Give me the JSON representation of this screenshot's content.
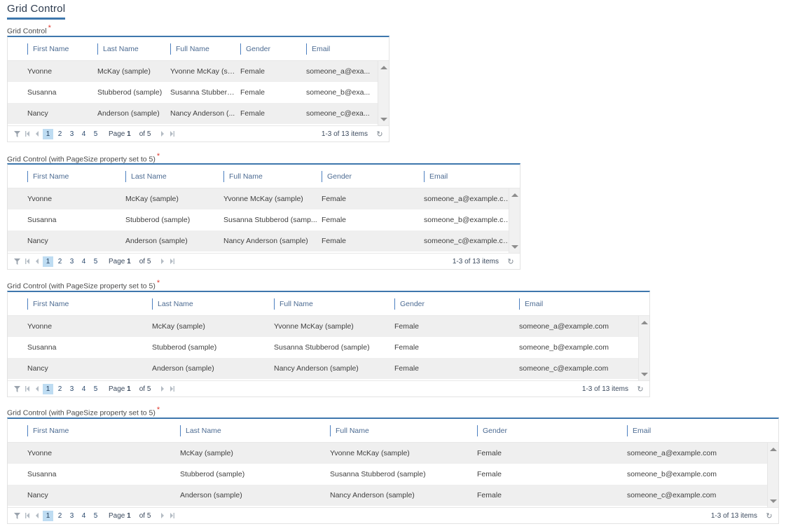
{
  "page": {
    "title": "Grid Control",
    "accent": "#3e77ad",
    "required_marker": "*"
  },
  "columns": [
    "First Name",
    "Last Name",
    "Full Name",
    "Gender",
    "Email"
  ],
  "rows_full": [
    {
      "first": "Yvonne",
      "last": "McKay (sample)",
      "full": "Yvonne McKay (sample)",
      "gender": "Female",
      "email": "someone_a@example.com"
    },
    {
      "first": "Susanna",
      "last": "Stubberod (sample)",
      "full": "Susanna Stubberod (sample)",
      "gender": "Female",
      "email": "someone_b@example.com"
    },
    {
      "first": "Nancy",
      "last": "Anderson (sample)",
      "full": "Nancy Anderson (sample)",
      "gender": "Female",
      "email": "someone_c@example.com"
    }
  ],
  "rows_truncated_narrow": [
    {
      "first": "Yvonne",
      "last": "McKay (sample)",
      "full": "Yvonne McKay (sa...",
      "gender": "Female",
      "email": "someone_a@exa..."
    },
    {
      "first": "Susanna",
      "last": "Stubberod (sample)",
      "full": "Susanna Stubbero...",
      "gender": "Female",
      "email": "someone_b@exa..."
    },
    {
      "first": "Nancy",
      "last": "Anderson (sample)",
      "full": "Nancy Anderson (...",
      "gender": "Female",
      "email": "someone_c@exa..."
    }
  ],
  "rows_truncated_medium": [
    {
      "first": "Yvonne",
      "last": "McKay (sample)",
      "full": "Yvonne McKay (sample)",
      "gender": "Female",
      "email": "someone_a@example.com"
    },
    {
      "first": "Susanna",
      "last": "Stubberod (sample)",
      "full": "Susanna Stubberod (samp...",
      "gender": "Female",
      "email": "someone_b@example.com"
    },
    {
      "first": "Nancy",
      "last": "Anderson (sample)",
      "full": "Nancy Anderson (sample)",
      "gender": "Female",
      "email": "someone_c@example.com"
    }
  ],
  "pager": {
    "pages": [
      "1",
      "2",
      "3",
      "4",
      "5"
    ],
    "active_page": "1",
    "page_label": "Page",
    "page_value": "1",
    "of_label": "of 5",
    "items_label": "1-3 of 13 items",
    "first_icon": "first-page-icon",
    "prev_icon": "previous-page-icon",
    "next_icon": "next-page-icon",
    "last_icon": "last-page-icon",
    "filter_icon": "filter-icon",
    "refresh_icon": "refresh-icon"
  },
  "grids": [
    {
      "label": "Grid Control"
    },
    {
      "label": "Grid Control (with PageSize property set to 5)"
    },
    {
      "label": "Grid Control (with PageSize property set to 5)"
    },
    {
      "label": "Grid Control (with PageSize property set to 5)"
    }
  ]
}
